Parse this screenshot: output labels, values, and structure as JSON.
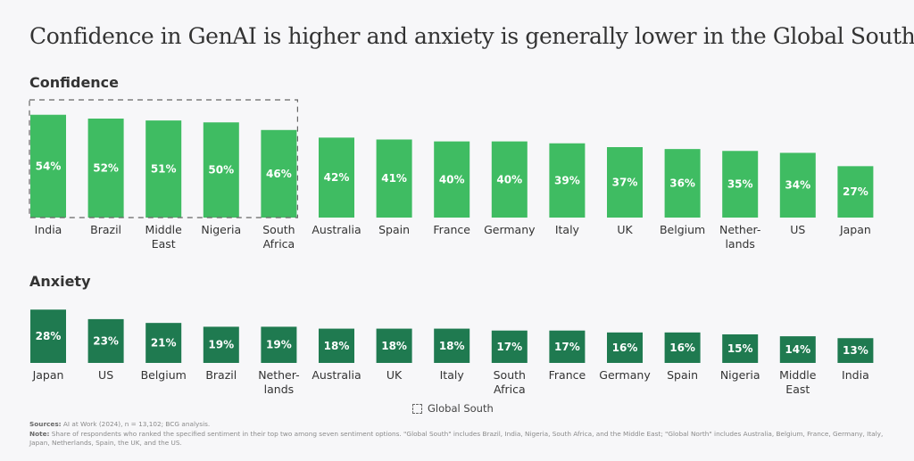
{
  "title": "Confidence in GenAI is higher and anxiety is generally lower in the Global South",
  "colors": {
    "background": "#f7f7f9",
    "confidence_bar": "#3fbc62",
    "anxiety_bar": "#1f7a50",
    "text": "#333333",
    "dashed_box": "#666666"
  },
  "legend": {
    "global_south_label": "Global South"
  },
  "footnote": {
    "sources_label": "Sources:",
    "sources_text": " AI at Work (2024), n = 13,102; BCG analysis.",
    "note_label": "Note:",
    "note_text": " Share of respondents who ranked the specified sentiment in their top two among seven sentiment options. \"Global South\" includes Brazil, India, Nigeria, South Africa, and the Middle East; \"Global North\" includes Australia, Belgium, France, Germany, Italy, Japan, Netherlands, Spain, the UK, and the US."
  },
  "chart_data": [
    {
      "type": "bar",
      "title": "Confidence",
      "unit": "%",
      "categories": [
        "India",
        "Brazil",
        "Middle East",
        "Nigeria",
        "South Africa",
        "Australia",
        "Spain",
        "France",
        "Germany",
        "Italy",
        "UK",
        "Belgium",
        "Netherlands",
        "US",
        "Japan"
      ],
      "category_lines": [
        [
          "India"
        ],
        [
          "Brazil"
        ],
        [
          "Middle",
          "East"
        ],
        [
          "Nigeria"
        ],
        [
          "South",
          "Africa"
        ],
        [
          "Australia"
        ],
        [
          "Spain"
        ],
        [
          "France"
        ],
        [
          "Germany"
        ],
        [
          "Italy"
        ],
        [
          "UK"
        ],
        [
          "Belgium"
        ],
        [
          "Nether-",
          "lands"
        ],
        [
          "US"
        ],
        [
          "Japan"
        ]
      ],
      "values": [
        54,
        52,
        51,
        50,
        46,
        42,
        41,
        40,
        40,
        39,
        37,
        36,
        35,
        34,
        27
      ],
      "data_labels": [
        "54%",
        "52%",
        "51%",
        "50%",
        "46%",
        "42%",
        "41%",
        "40%",
        "40%",
        "39%",
        "37%",
        "36%",
        "35%",
        "34%",
        "27%"
      ],
      "highlight_group": {
        "name": "Global South",
        "categories": [
          "India",
          "Brazil",
          "Middle East",
          "Nigeria",
          "South Africa"
        ],
        "style": "dashed-box"
      },
      "xlabel": "",
      "ylabel": "",
      "ylim": [
        0,
        60
      ],
      "grid": false,
      "axes_visible": false
    },
    {
      "type": "bar",
      "title": "Anxiety",
      "unit": "%",
      "categories": [
        "Japan",
        "US",
        "Belgium",
        "Brazil",
        "Netherlands",
        "Australia",
        "UK",
        "Italy",
        "South Africa",
        "France",
        "Germany",
        "Spain",
        "Nigeria",
        "Middle East",
        "India"
      ],
      "category_lines": [
        [
          "Japan"
        ],
        [
          "US"
        ],
        [
          "Belgium"
        ],
        [
          "Brazil"
        ],
        [
          "Nether-",
          "lands"
        ],
        [
          "Australia"
        ],
        [
          "UK"
        ],
        [
          "Italy"
        ],
        [
          "South",
          "Africa"
        ],
        [
          "France"
        ],
        [
          "Germany"
        ],
        [
          "Spain"
        ],
        [
          "Nigeria"
        ],
        [
          "Middle",
          "East"
        ],
        [
          "India"
        ]
      ],
      "values": [
        28,
        23,
        21,
        19,
        19,
        18,
        18,
        18,
        17,
        17,
        16,
        16,
        15,
        14,
        13
      ],
      "data_labels": [
        "28%",
        "23%",
        "21%",
        "19%",
        "19%",
        "18%",
        "18%",
        "18%",
        "17%",
        "17%",
        "16%",
        "16%",
        "15%",
        "14%",
        "13%"
      ],
      "xlabel": "",
      "ylabel": "",
      "ylim": [
        0,
        60
      ],
      "grid": false,
      "axes_visible": false
    }
  ]
}
